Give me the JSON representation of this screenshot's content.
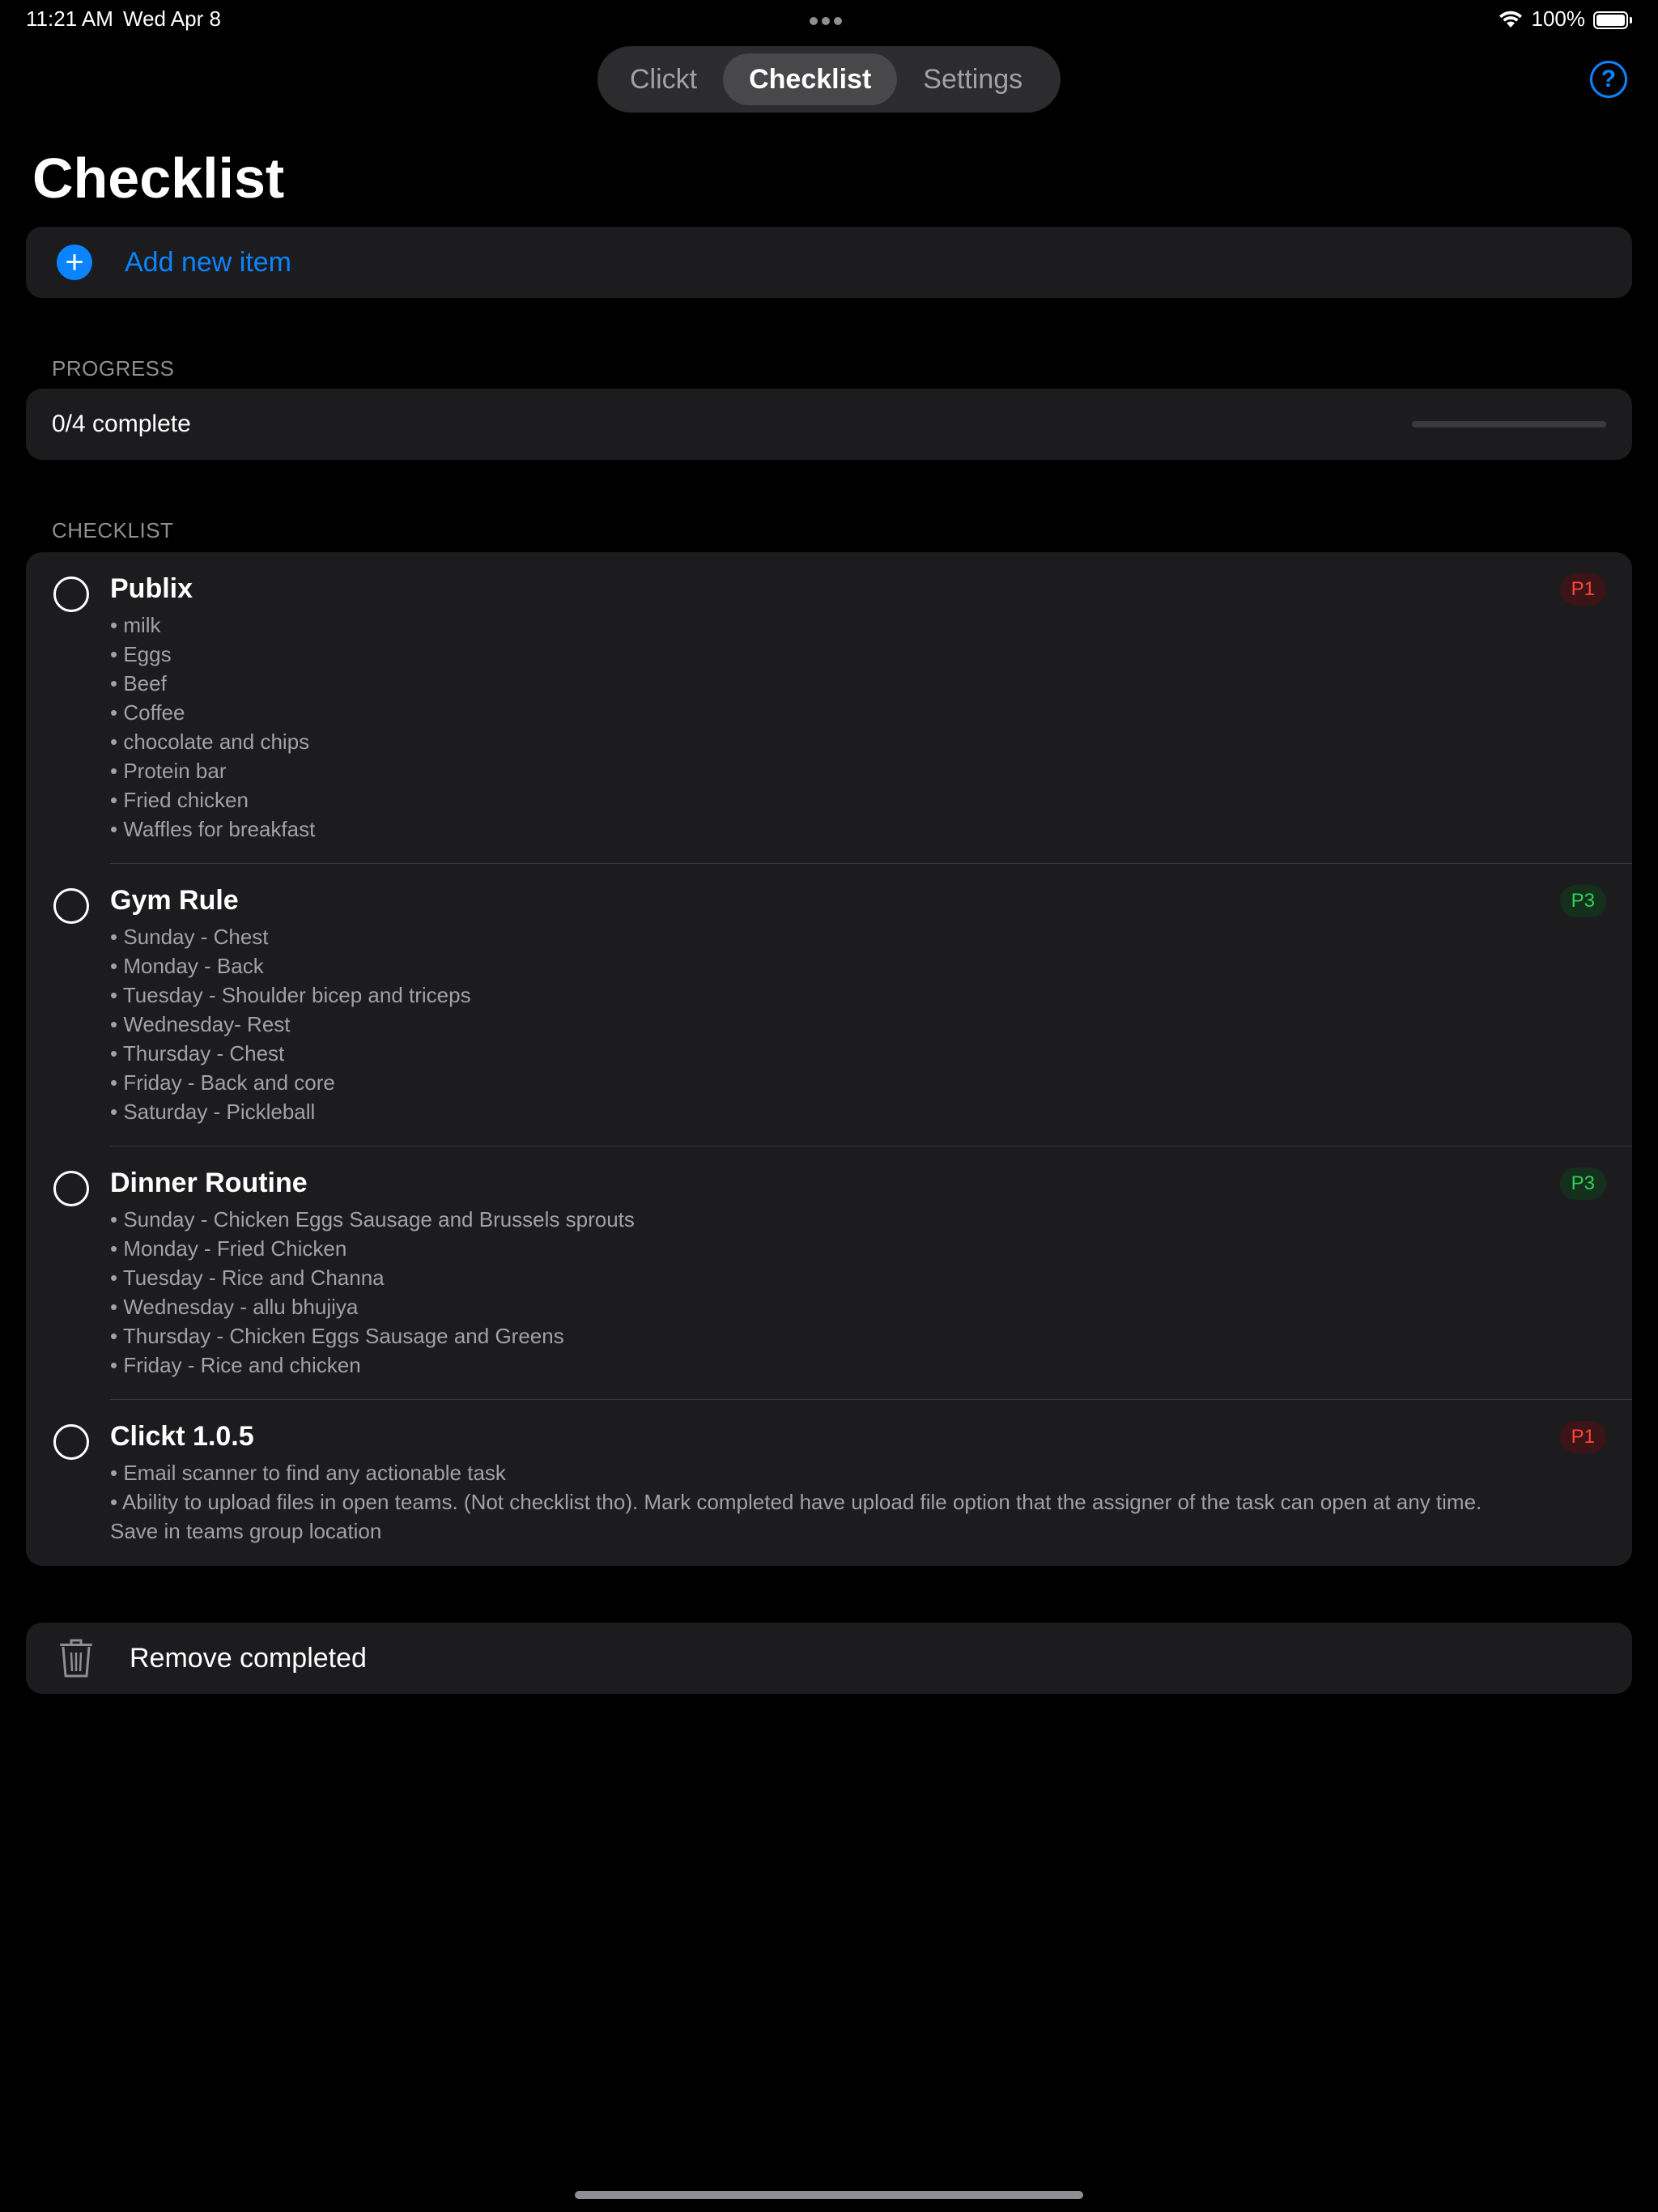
{
  "status_bar": {
    "time": "11:21 AM",
    "date": "Wed Apr 8",
    "battery": "100%"
  },
  "tabs": [
    {
      "label": "Clickt",
      "active": false
    },
    {
      "label": "Checklist",
      "active": true
    },
    {
      "label": "Settings",
      "active": false
    }
  ],
  "help_icon": "?",
  "page_title": "Checklist",
  "add_item": {
    "icon": "+",
    "label": "Add new item"
  },
  "progress": {
    "header": "PROGRESS",
    "text": "0/4 complete",
    "completed": 0,
    "total": 4
  },
  "checklist": {
    "header": "CHECKLIST",
    "items": [
      {
        "title": "Publix",
        "priority": "P1",
        "lines": [
          "• milk",
          "• Eggs",
          "• Beef",
          "• Coffee",
          "• chocolate and chips",
          "• Protein bar",
          "• Fried chicken",
          "• Waffles for breakfast"
        ]
      },
      {
        "title": "Gym Rule",
        "priority": "P3",
        "lines": [
          "• Sunday - Chest",
          "• Monday - Back",
          "• Tuesday - Shoulder bicep and triceps",
          "• Wednesday- Rest",
          "• Thursday - Chest",
          "• Friday - Back and core",
          "• Saturday - Pickleball"
        ]
      },
      {
        "title": "Dinner Routine",
        "priority": "P3",
        "lines": [
          "• Sunday - Chicken Eggs Sausage and Brussels sprouts",
          "• Monday - Fried Chicken",
          "• Tuesday - Rice and Channa",
          "• Wednesday - allu bhujiya",
          "• Thursday - Chicken Eggs Sausage and Greens",
          "• Friday - Rice and chicken"
        ]
      },
      {
        "title": "Clickt 1.0.5",
        "priority": "P1",
        "lines": [
          "• Email scanner to find any actionable task",
          "• Ability to upload files in open teams. (Not checklist tho). Mark completed have upload file option that the assigner of the task can open at any time. Save in teams group location"
        ]
      }
    ]
  },
  "remove_completed": {
    "label": "Remove completed",
    "icon": "trash-icon"
  },
  "colors": {
    "accent": "#0a84ff",
    "p1": "#ff453a",
    "p3": "#30d158",
    "card": "#1c1c1e"
  }
}
